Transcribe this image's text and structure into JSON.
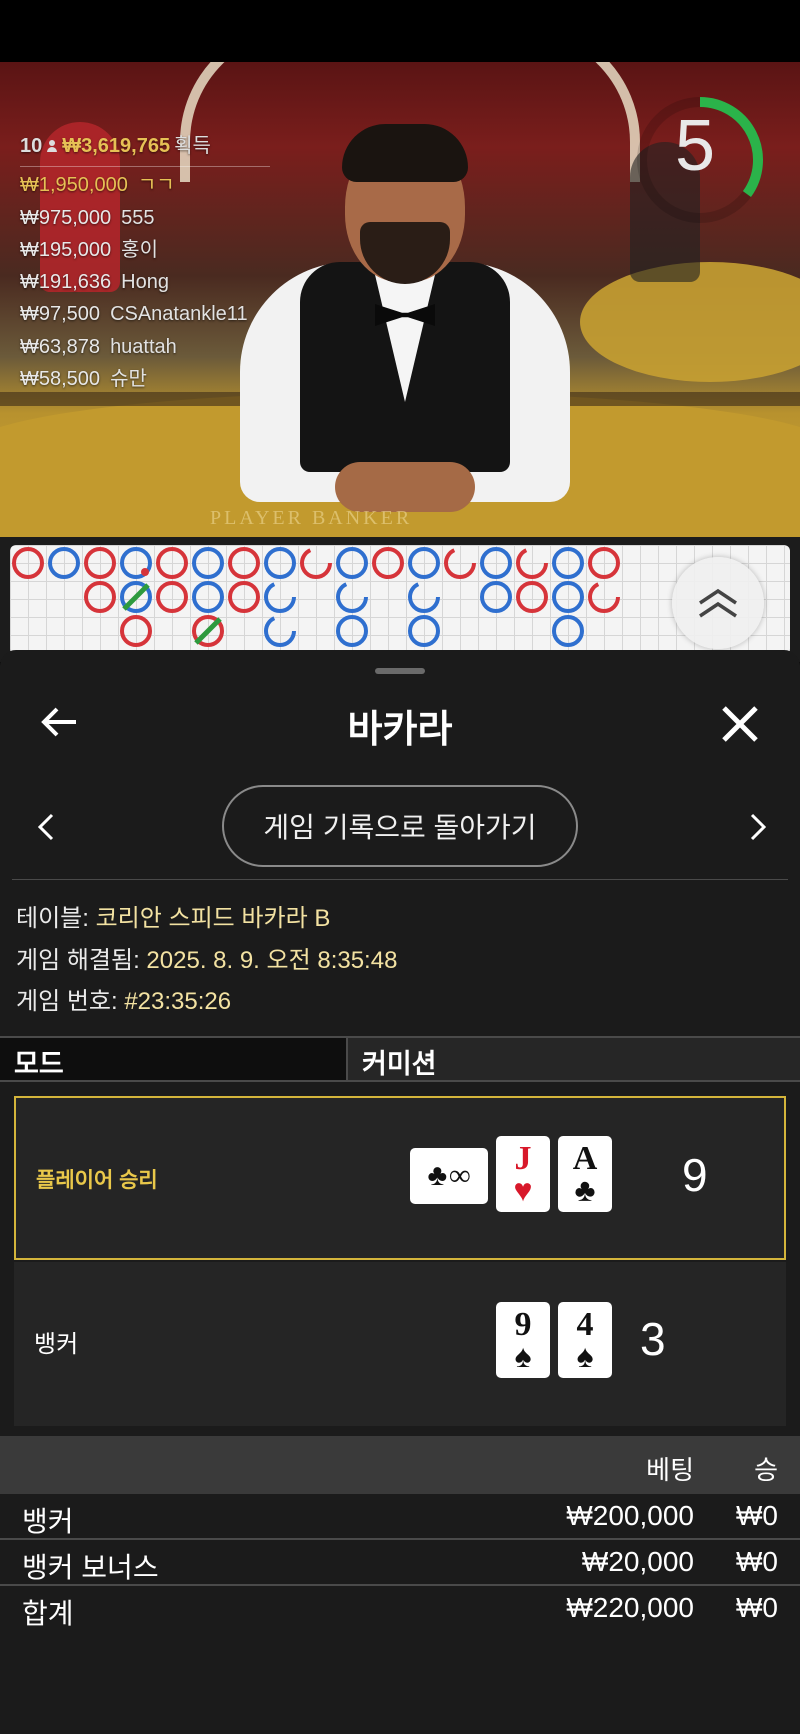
{
  "video": {
    "felt_text": "PLAYER   BANKER",
    "winners_header": {
      "count": "10",
      "total": "₩3,619,765",
      "earned_label": "획득"
    },
    "winners": [
      {
        "amount": "₩1,950,000",
        "name": "ㄱㄱ"
      },
      {
        "amount": "₩975,000",
        "name": "555"
      },
      {
        "amount": "₩195,000",
        "name": "홍이"
      },
      {
        "amount": "₩191,636",
        "name": "Hong"
      },
      {
        "amount": "₩97,500",
        "name": "CSAnatankle11"
      },
      {
        "amount": "₩63,878",
        "name": "huattah"
      },
      {
        "amount": "₩58,500",
        "name": "슈만"
      }
    ],
    "timer": {
      "seconds": "5",
      "remaining_fraction": 0.35,
      "color": "#2bb34a"
    }
  },
  "road_colors": {
    "banker": "#d6343a",
    "player": "#2f6fcf",
    "tie": "#2e9a3e"
  },
  "sheet": {
    "title": "바카라",
    "back_to_history": "게임 기록으로 돌아가기",
    "info": {
      "table_label": "테이블:",
      "table_value": "코리안 스피드 바카라 B",
      "resolved_label": "게임 해결됨:",
      "resolved_value": "2025. 8. 9. 오전 8:35:48",
      "number_label": "게임 번호:",
      "number_value": "#23:35:26"
    },
    "mode_label": "모드",
    "commission_label": "커미션",
    "player": {
      "label": "플레이어 승리",
      "cards": [
        {
          "rank": "∞",
          "suit": "♣",
          "color": "black",
          "note": "wide"
        },
        {
          "rank": "J",
          "suit": "♥",
          "color": "red"
        },
        {
          "rank": "A",
          "suit": "♣",
          "color": "black"
        }
      ],
      "score": "9"
    },
    "banker": {
      "label": "뱅커",
      "cards": [
        {
          "rank": "9",
          "suit": "♠",
          "color": "black"
        },
        {
          "rank": "4",
          "suit": "♠",
          "color": "black"
        }
      ],
      "score": "3"
    },
    "bets": {
      "col_bet": "베팅",
      "col_win": "승",
      "rows": [
        {
          "name": "뱅커",
          "amount": "₩200,000",
          "win": "₩0"
        },
        {
          "name": "뱅커 보너스",
          "amount": "₩20,000",
          "win": "₩0"
        },
        {
          "name": "합계",
          "amount": "₩220,000",
          "win": "₩0"
        }
      ]
    }
  }
}
